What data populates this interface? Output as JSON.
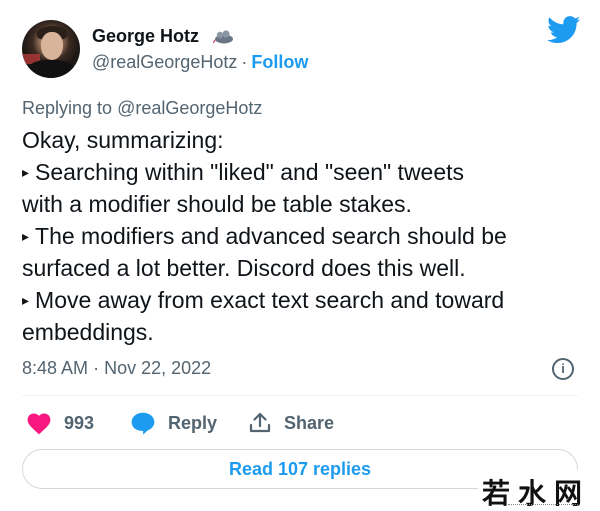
{
  "tweet": {
    "author": {
      "name": "George Hotz",
      "handle": "@realGeorgeHotz",
      "follow_label": "Follow",
      "badge_icon": "cloud-rat-emoji-icon"
    },
    "platform_icon": "twitter-bird-icon",
    "replying_prefix": "Replying to",
    "replying_to": "@realGeorgeHotz",
    "body_lines": [
      "Okay, summarizing:",
      "Searching within \"liked\" and \"seen\" tweets",
      "with a modifier should be table stakes.",
      "The modifiers and advanced search should be",
      "surfaced a lot better. Discord does this well.",
      "Move away from exact text search and toward",
      "embeddings."
    ],
    "bullet_glyph": "▸",
    "time": "8:48 AM",
    "date": "Nov 22, 2022",
    "meta_separator": "·",
    "actions": {
      "like_count": "993",
      "reply_label": "Reply",
      "share_label": "Share"
    },
    "read_replies_label": "Read 107 replies"
  },
  "watermark": {
    "text": "若水网"
  },
  "colors": {
    "accent": "#1d9bf0",
    "like": "#f91880",
    "muted_text": "#536471",
    "primary_text": "#0f1419",
    "border": "#cfd9de"
  }
}
